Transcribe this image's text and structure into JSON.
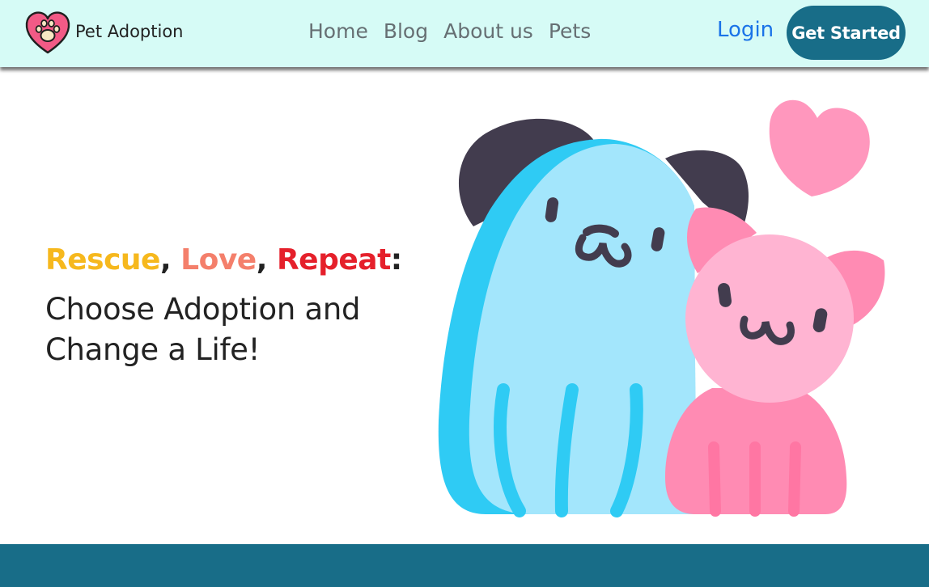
{
  "brand": {
    "name": "Pet Adoption",
    "logo_icon": "heart-paw-icon"
  },
  "nav": {
    "links": [
      "Home",
      "Blog",
      "About us",
      "Pets"
    ]
  },
  "auth": {
    "login_label": "Login",
    "cta_label": "Get Started"
  },
  "hero": {
    "tagline": {
      "word1": "Rescue",
      "sep1": ", ",
      "word2": "Love",
      "sep2": ", ",
      "word3": "Repeat",
      "end": ":"
    },
    "headline_line1": "Choose Adoption and",
    "headline_line2": "Change a Life!",
    "illustration_icon": "dog-and-cat-illustration"
  },
  "colors": {
    "navbar_bg": "#d6fbf6",
    "accent": "#186d88",
    "link": "#1a73e8",
    "word1": "#f6b81d",
    "word2": "#f47f6b",
    "word3": "#e5202b"
  }
}
